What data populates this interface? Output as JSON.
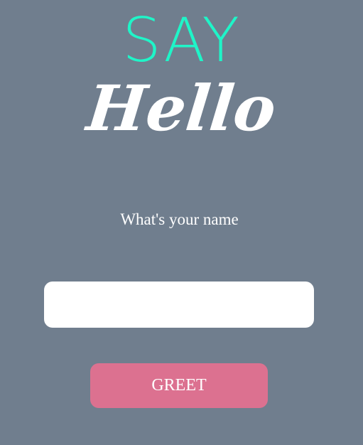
{
  "logo": {
    "say": "SAY",
    "hello": "Hello"
  },
  "form": {
    "prompt": "What's your name",
    "name_value": "",
    "name_placeholder": "",
    "greet_label": "GREET"
  },
  "colors": {
    "background": "#707e8e",
    "accent": "#1ff5c8",
    "button": "#dc7190",
    "text": "#ffffff"
  }
}
